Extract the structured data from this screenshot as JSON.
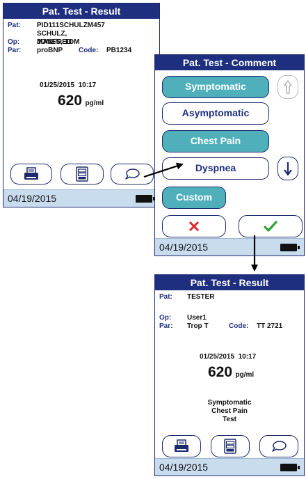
{
  "screen1": {
    "title": "Pat. Test - Result",
    "pat_label": "Pat:",
    "pat_value1": "PID111SCHULZM457",
    "pat_value2": "SCHULZ, MANFRED",
    "op_label": "Op:",
    "op_value": "JONES, TOM",
    "par_label": "Par:",
    "par_value": "proBNP",
    "code_label": "Code:",
    "code_value": "PB1234",
    "datetime": "01/25/2015  10:17",
    "result_value": "620",
    "result_unit": "pg/ml",
    "status_date": "04/19/2015"
  },
  "screen2": {
    "title": "Pat. Test - Comment",
    "comments": [
      {
        "label": "Symptomatic",
        "selected": true
      },
      {
        "label": "Asymptomatic",
        "selected": false
      },
      {
        "label": "Chest Pain",
        "selected": true
      },
      {
        "label": "Dyspnea",
        "selected": false
      },
      {
        "label": "Custom",
        "selected": true
      }
    ],
    "scroll_up_enabled": false,
    "scroll_down_enabled": true,
    "status_date": "04/19/2015"
  },
  "screen3": {
    "title": "Pat. Test - Result",
    "pat_label": "Pat:",
    "pat_value": "TESTER",
    "op_label": "Op:",
    "op_value": "User1",
    "par_label": "Par:",
    "par_value": "Trop T",
    "code_label": "Code:",
    "code_value": "TT 2721",
    "datetime": "01/25/2015  10:17",
    "result_value": "620",
    "result_unit": "pg/ml",
    "comment_line1": "Symptomatic",
    "comment_line2": "Chest Pain",
    "comment_line3": "Test",
    "status_date": "04/19/2015"
  },
  "colors": {
    "title_bar": "#1e2f80",
    "selected_button": "#4fb0bb",
    "status_bar": "#c9dcee",
    "cancel": "#e0242b",
    "confirm": "#2fa02f"
  },
  "icons": [
    "printer-icon",
    "list-icon",
    "comment-icon",
    "up-arrow-icon",
    "down-arrow-icon",
    "cancel-x-icon",
    "confirm-check-icon"
  ]
}
